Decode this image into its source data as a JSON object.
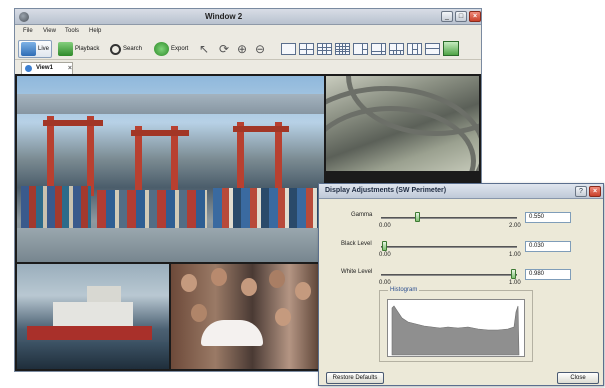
{
  "window": {
    "title": "Window 2",
    "controls": {
      "minimize": "_",
      "maximize": "□",
      "close": "×"
    }
  },
  "menu": [
    "File",
    "View",
    "Tools",
    "Help"
  ],
  "toolbar": {
    "live_label": "Live",
    "playback_label": "Playback",
    "search_label": "Search",
    "export_label": "Export"
  },
  "tabs": [
    {
      "label": "View1",
      "close": "×"
    }
  ],
  "dialog": {
    "title": "Display Adjustments (SW Perimeter)",
    "help": "?",
    "close": "×",
    "sliders": [
      {
        "label": "Gamma",
        "min": "0.00",
        "max": "2.00",
        "value": "0.550",
        "fraction": 0.275
      },
      {
        "label": "Black Level",
        "min": "0.00",
        "max": "1.00",
        "value": "0.030",
        "fraction": 0.03
      },
      {
        "label": "White Level",
        "min": "0.00",
        "max": "1.00",
        "value": "0.980",
        "fraction": 0.98
      }
    ],
    "histogram_title": "Histogram",
    "restore_label": "Restore Defaults",
    "close_label": "Close"
  }
}
